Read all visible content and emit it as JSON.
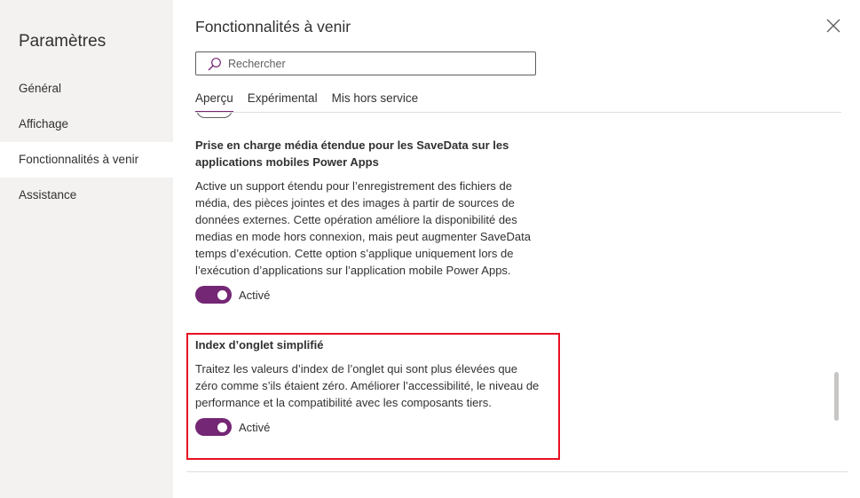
{
  "sidebar": {
    "title": "Paramètres",
    "items": [
      {
        "label": "Général",
        "active": false
      },
      {
        "label": "Affichage",
        "active": false
      },
      {
        "label": "Fonctionnalités à venir",
        "active": true
      },
      {
        "label": "Assistance",
        "active": false
      }
    ]
  },
  "panel": {
    "title": "Fonctionnalités à venir",
    "close_icon": "close-icon",
    "search": {
      "placeholder": "Rechercher",
      "value": "",
      "icon": "search-icon"
    },
    "tabs": [
      {
        "label": "Aperçu",
        "active": true
      },
      {
        "label": "Expérimental",
        "active": false
      },
      {
        "label": "Mis hors service",
        "active": false
      }
    ]
  },
  "features": [
    {
      "title": "Prise en charge média étendue pour les SaveData sur les applications mobiles Power Apps",
      "description": "Active un support étendu pour l’enregistrement des fichiers de média, des pièces jointes et des images à partir de sources de données externes. Cette opération améliore la disponibilité des medias en mode hors connexion, mais peut augmenter SaveData temps d’exécution. Cette option s’applique uniquement lors de l’exécution d’applications sur l’application mobile Power Apps.",
      "toggle_on": true,
      "toggle_label": "Activé"
    },
    {
      "title": "Index d’onglet simplifié",
      "description": "Traitez les valeurs d’index de l’onglet qui sont plus élevées que zéro comme s’ils étaient zéro. Améliorer l’accessibilité, le niveau de performance et la compatibilité avec les composants tiers.",
      "toggle_on": true,
      "toggle_label": "Activé",
      "highlighted": true
    }
  ],
  "colors": {
    "accent": "#742774",
    "highlight_border": "#e81123",
    "sidebar_bg": "#f3f2f1"
  }
}
